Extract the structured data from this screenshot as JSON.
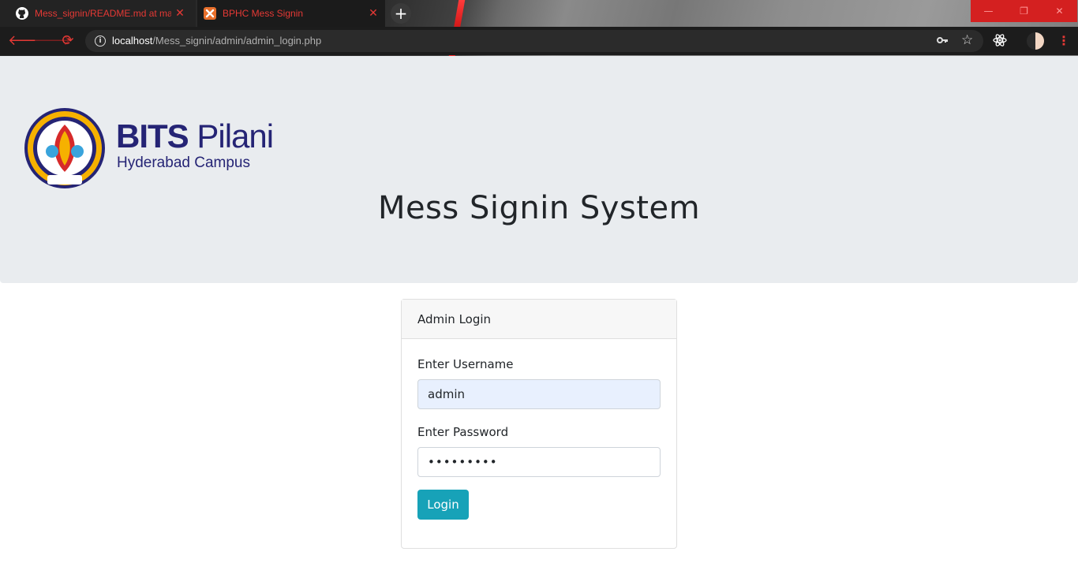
{
  "browser": {
    "tabs": [
      {
        "title": "Mess_signin/README.md at master",
        "icon": "github-icon"
      },
      {
        "title": "BPHC Mess Signin",
        "icon": "xampp-icon"
      }
    ],
    "new_tab": "+",
    "window": {
      "minimize": "—",
      "maximize": "❐",
      "close": "✕"
    },
    "url_host": "localhost",
    "url_path": "/Mess_signin/admin/admin_login.php",
    "accent_color": "#e53935"
  },
  "header": {
    "logo_bits": "BITS",
    "logo_pilani": "Pilani",
    "logo_campus": "Hyderabad Campus",
    "title": "Mess Signin System"
  },
  "login": {
    "card_title": "Admin Login",
    "username_label": "Enter Username",
    "username_value": "admin",
    "password_label": "Enter Password",
    "password_value": "•••••••••",
    "submit_label": "Login",
    "button_color": "#17a2b8"
  }
}
